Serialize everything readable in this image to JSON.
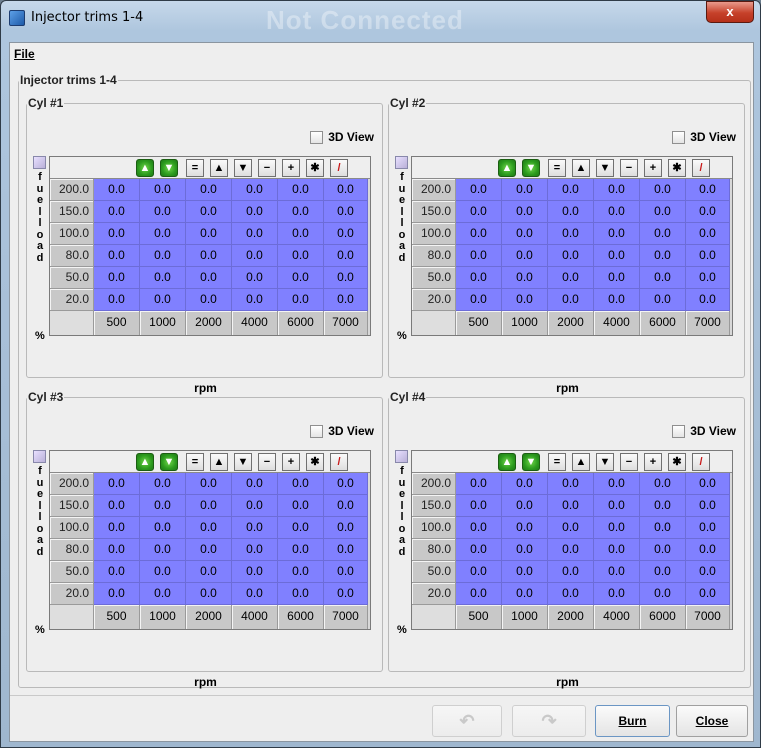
{
  "window": {
    "title": "Injector trims 1-4",
    "ghost_title": "Not Connected",
    "close_glyph": "x"
  },
  "menu": {
    "file": "File"
  },
  "group": {
    "title": "Injector trims 1-4"
  },
  "cyl_titles": [
    "Cyl #1",
    "Cyl #2",
    "Cyl #3",
    "Cyl #4"
  ],
  "view3d_label": "3D View",
  "y_axis_letters": [
    "f",
    "u",
    "e",
    "l",
    "l",
    "o",
    "a",
    "d"
  ],
  "y_axis_unit": "%",
  "x_axis_label": "rpm",
  "toolbar_buttons": [
    {
      "icon": "up-green-icon",
      "glyph": "▲",
      "style": "green"
    },
    {
      "icon": "down-green-icon",
      "glyph": "▼",
      "style": "green"
    },
    {
      "icon": "equals-icon",
      "glyph": "=",
      "style": ""
    },
    {
      "icon": "increase-icon",
      "glyph": "▲",
      "style": ""
    },
    {
      "icon": "decrease-icon",
      "glyph": "▼",
      "style": ""
    },
    {
      "icon": "minus-icon",
      "glyph": "−",
      "style": ""
    },
    {
      "icon": "plus-icon",
      "glyph": "+",
      "style": ""
    },
    {
      "icon": "multiply-icon",
      "glyph": "✱",
      "style": ""
    },
    {
      "icon": "pencil-icon",
      "glyph": "/",
      "style": "red"
    }
  ],
  "load_bins": [
    "200.0",
    "150.0",
    "100.0",
    "80.0",
    "50.0",
    "20.0"
  ],
  "rpm_bins": [
    "500",
    "1000",
    "2000",
    "4000",
    "6000",
    "7000"
  ],
  "cell_value": "0.0",
  "buttons": {
    "undo_glyph": "↶",
    "redo_glyph": "↷",
    "burn": "Burn",
    "close": "Close"
  }
}
